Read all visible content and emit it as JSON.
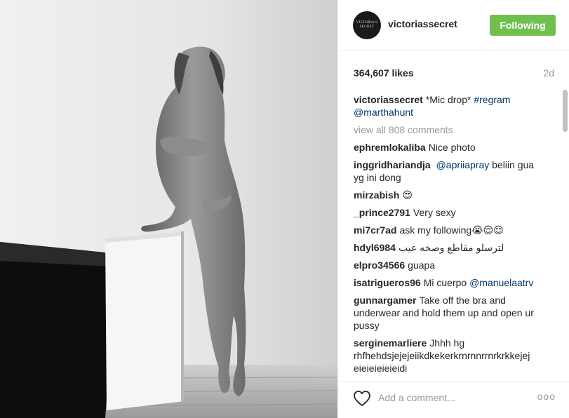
{
  "post": {
    "username": "victoriassecret",
    "avatar_text": "VICTORIA'S SECRET",
    "follow_label": "Following",
    "likes": "364,607 likes",
    "age": "2d"
  },
  "caption": {
    "username": "victoriassecret",
    "text": "*Mic drop*",
    "hashtag": "#regram",
    "mention": "@marthahunt"
  },
  "view_all": "view all 808 comments",
  "comments": [
    {
      "user": "ephremlokaliba",
      "pre": "Nice photo",
      "link": "",
      "post": ""
    },
    {
      "user": "inggridhariandja",
      "pre": "",
      "link": "@apriiapray",
      "post": "beliin gua yg ini dong"
    },
    {
      "user": "mirzabish",
      "pre": "😍",
      "link": "",
      "post": ""
    },
    {
      "user": "_prince2791",
      "pre": "Very sexy",
      "link": "",
      "post": ""
    },
    {
      "user": "mi7cr7ad",
      "pre": "ask my following😭😌😌",
      "link": "",
      "post": ""
    },
    {
      "user": "hdyl6984",
      "pre": "لترسلو مقاطع وصخه عيب",
      "link": "",
      "post": ""
    },
    {
      "user": "elpro34566",
      "pre": "guapa",
      "link": "",
      "post": ""
    },
    {
      "user": "isatrigueros96",
      "pre": "Mi cuerpo",
      "link": "@manuelaatrv",
      "post": ""
    },
    {
      "user": "gunnargamer",
      "pre": "Take off the bra and underwear and hold them up and open ur pussy",
      "link": "",
      "post": ""
    },
    {
      "user": "serginemarliere",
      "pre": "Jhhh hg rhfhehdsjejejeiikdkekerkrnrnnrrnrkrkkejej eieieieieieidi",
      "link": "",
      "post": ""
    }
  ],
  "footer": {
    "placeholder": "Add a comment...",
    "more": "ooo"
  },
  "icons": {
    "heart": "heart-icon",
    "more": "more-options-icon"
  },
  "colors": {
    "follow_button": "#70c050",
    "link": "#003569",
    "muted": "#999999"
  }
}
